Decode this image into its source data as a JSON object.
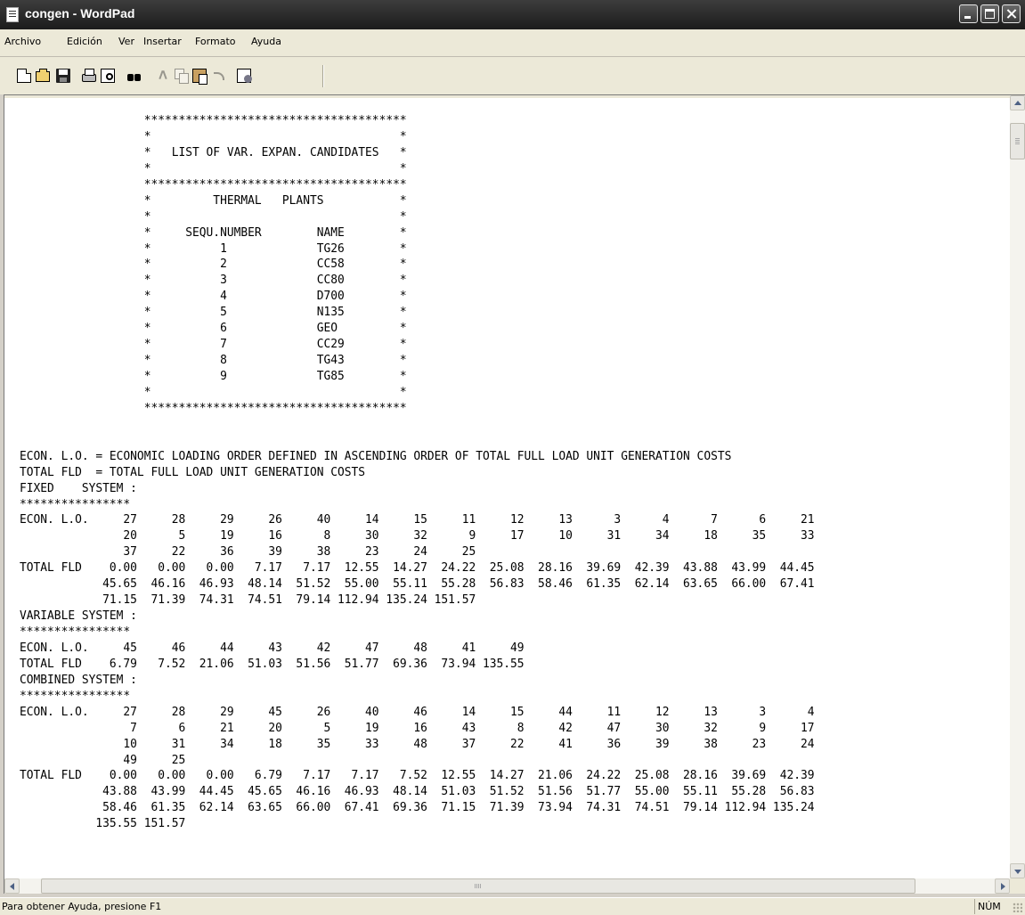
{
  "window": {
    "title": "congen - WordPad"
  },
  "menubar": {
    "items": [
      "Archivo",
      "Edición",
      "Ver",
      "Insertar",
      "Formato",
      "Ayuda"
    ]
  },
  "toolbar": {
    "icons": [
      "new-document-icon",
      "open-folder-icon",
      "save-disk-icon",
      "print-icon",
      "print-preview-icon",
      "find-binoculars-icon",
      "cut-scissors-icon",
      "copy-icon",
      "paste-icon",
      "undo-icon",
      "insert-object-icon"
    ]
  },
  "document": {
    "lines": [
      "                  **************************************",
      "                  *                                    *",
      "                  *   LIST OF VAR. EXPAN. CANDIDATES   *",
      "                  *                                    *",
      "                  **************************************",
      "                  *         THERMAL   PLANTS           *",
      "                  *                                    *",
      "                  *     SEQU.NUMBER        NAME        *",
      "                  *          1             TG26        *",
      "                  *          2             CC58        *",
      "                  *          3             CC80        *",
      "                  *          4             D700        *",
      "                  *          5             N135        *",
      "                  *          6             GEO         *",
      "                  *          7             CC29        *",
      "                  *          8             TG43        *",
      "                  *          9             TG85        *",
      "                  *                                    *",
      "                  **************************************",
      "",
      "",
      "ECON. L.O. = ECONOMIC LOADING ORDER DEFINED IN ASCENDING ORDER OF TOTAL FULL LOAD UNIT GENERATION COSTS",
      "TOTAL FLD  = TOTAL FULL LOAD UNIT GENERATION COSTS",
      "FIXED    SYSTEM :",
      "****************",
      "ECON. L.O.     27     28     29     26     40     14     15     11     12     13      3      4      7      6     21",
      "               20      5     19     16      8     30     32      9     17     10     31     34     18     35     33",
      "               37     22     36     39     38     23     24     25",
      "TOTAL FLD    0.00   0.00   0.00   7.17   7.17  12.55  14.27  24.22  25.08  28.16  39.69  42.39  43.88  43.99  44.45",
      "            45.65  46.16  46.93  48.14  51.52  55.00  55.11  55.28  56.83  58.46  61.35  62.14  63.65  66.00  67.41",
      "            71.15  71.39  74.31  74.51  79.14 112.94 135.24 151.57",
      "VARIABLE SYSTEM :",
      "****************",
      "ECON. L.O.     45     46     44     43     42     47     48     41     49",
      "TOTAL FLD    6.79   7.52  21.06  51.03  51.56  51.77  69.36  73.94 135.55",
      "COMBINED SYSTEM :",
      "****************",
      "ECON. L.O.     27     28     29     45     26     40     46     14     15     44     11     12     13      3      4",
      "                7      6     21     20      5     19     16     43      8     42     47     30     32      9     17",
      "               10     31     34     18     35     33     48     37     22     41     36     39     38     23     24",
      "               49     25",
      "TOTAL FLD    0.00   0.00   0.00   6.79   7.17   7.17   7.52  12.55  14.27  21.06  24.22  25.08  28.16  39.69  42.39",
      "            43.88  43.99  44.45  45.65  46.16  46.93  48.14  51.03  51.52  51.56  51.77  55.00  55.11  55.28  56.83",
      "            58.46  61.35  62.14  63.65  66.00  67.41  69.36  71.15  71.39  73.94  74.31  74.51  79.14 112.94 135.24",
      "           135.55 151.57"
    ]
  },
  "statusbar": {
    "help_text": "Para obtener Ayuda, presione F1",
    "num_indicator": "NÚM"
  }
}
